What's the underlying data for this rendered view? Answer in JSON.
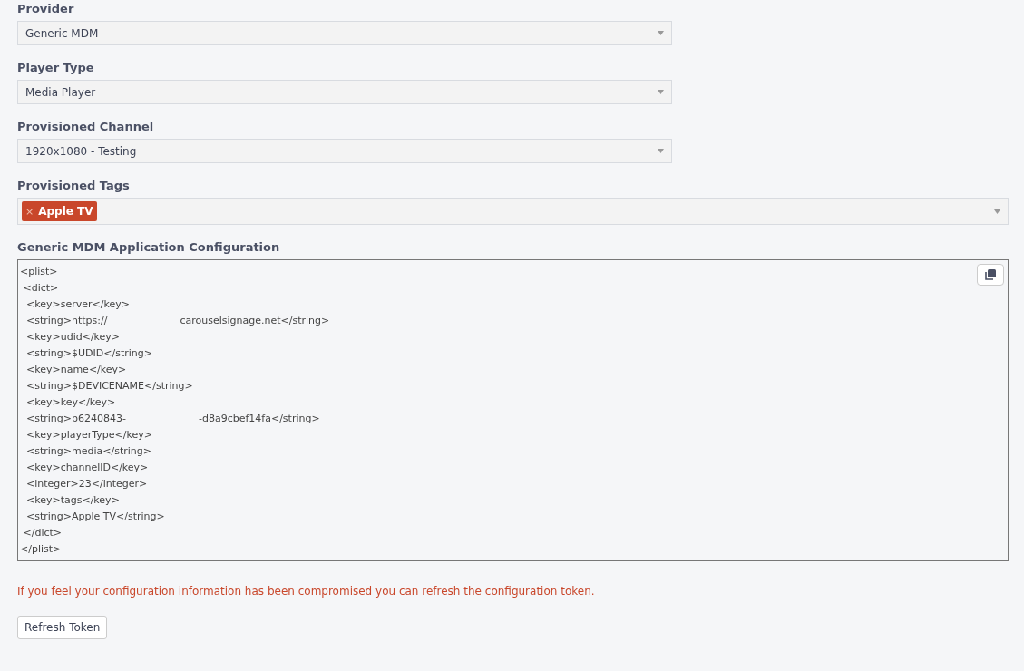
{
  "selects": [
    {
      "label": "Provider",
      "value": "Generic MDM"
    },
    {
      "label": "Player Type",
      "value": "Media Player"
    },
    {
      "label": "Provisioned Channel",
      "value": "1920x1080 - Testing"
    }
  ],
  "tags": {
    "label": "Provisioned Tags",
    "items": [
      {
        "remove": "×",
        "text": "Apple TV"
      }
    ]
  },
  "config": {
    "label": "Generic MDM Application Configuration",
    "lines": [
      [
        "<plist>"
      ],
      [
        " <dict>"
      ],
      [
        "  <key>server</key>"
      ],
      [
        "  <string>https://",
        "carouselsignage.net</string>"
      ],
      [
        "  <key>udid</key>"
      ],
      [
        "  <string>$UDID</string>"
      ],
      [
        "  <key>name</key>"
      ],
      [
        "  <string>$DEVICENAME</string>"
      ],
      [
        "  <key>key</key>"
      ],
      [
        "  <string>b6240843-",
        "-d8a9cbef14fa</string>"
      ],
      [
        "  <key>playerType</key>"
      ],
      [
        "  <string>media</string>"
      ],
      [
        "  <key>channelID</key>"
      ],
      [
        "  <integer>23</integer>"
      ],
      [
        "  <key>tags</key>"
      ],
      [
        "  <string>Apple TV</string>"
      ],
      [
        " </dict>"
      ],
      [
        "</plist>"
      ]
    ]
  },
  "warning": "If you feel your configuration information has been compromised you can refresh the configuration token.",
  "button": "Refresh Token"
}
